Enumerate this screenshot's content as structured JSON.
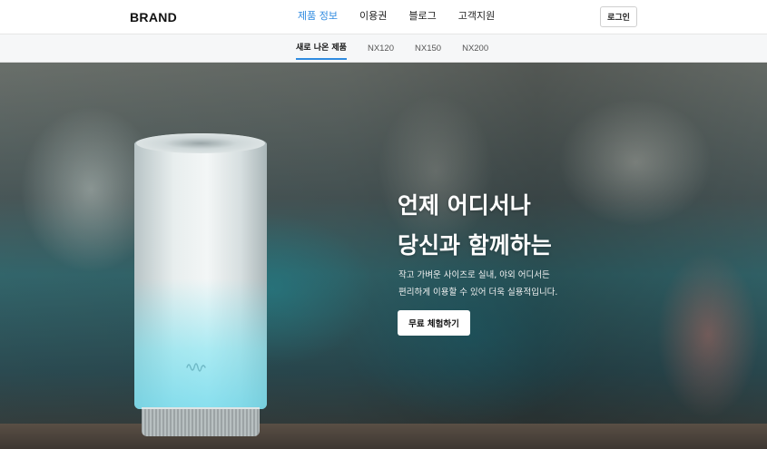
{
  "header": {
    "brand": "BRAND",
    "menu": [
      {
        "label": "제품 정보",
        "active": true
      },
      {
        "label": "이용권",
        "active": false
      },
      {
        "label": "블로그",
        "active": false
      },
      {
        "label": "고객지원",
        "active": false
      }
    ],
    "login_label": "로그인"
  },
  "subnav": {
    "items": [
      {
        "label": "새로 나온 제품",
        "active": true
      },
      {
        "label": "NX120",
        "active": false
      },
      {
        "label": "NX150",
        "active": false
      },
      {
        "label": "NX200",
        "active": false
      }
    ]
  },
  "hero": {
    "title_line1": "언제 어디서나",
    "title_line2": "당신과 함께하는",
    "desc_line1": "작고 가벼운 사이즈로 실내, 야외 어디서든",
    "desc_line2": "편리하게 이용할 수 있어 더욱 실용적입니다.",
    "cta_label": "무료 체험하기"
  },
  "colors": {
    "accent": "#2f8be0",
    "text": "#222222"
  },
  "icons": {
    "device_logo": "wave-icon"
  }
}
